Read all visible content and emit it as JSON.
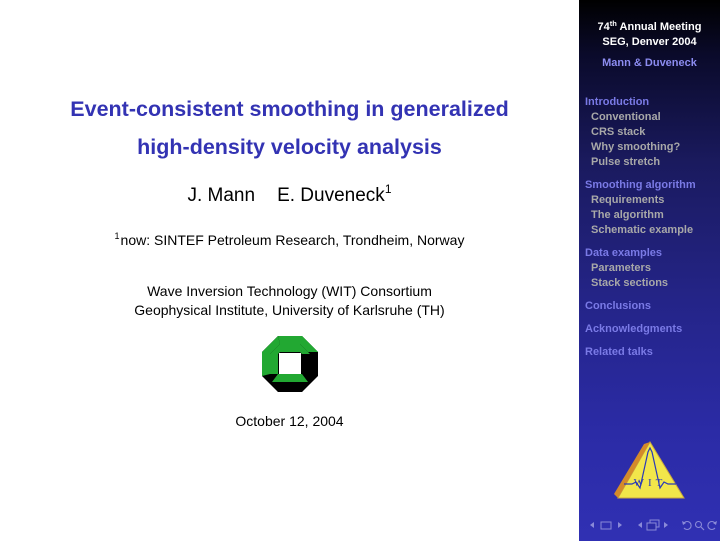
{
  "slide": {
    "title_line1": "Event-consistent smoothing in generalized",
    "title_line2": "high-density velocity analysis",
    "author1": "J. Mann",
    "author2": "E. Duveneck",
    "author2_footnote_mark": "1",
    "affiliation_mark": "1",
    "affiliation": "now: SINTEF Petroleum Research, Trondheim, Norway",
    "institution_line1": "Wave Inversion Technology (WIT) Consortium",
    "institution_line2": "Geophysical Institute, University of Karlsruhe (TH)",
    "date": "October 12, 2004",
    "title_color": "#3333b3"
  },
  "sidebar": {
    "meeting_number": "74",
    "meeting_sup": "th",
    "meeting_rest": " Annual Meeting",
    "meeting_line2": "SEG, Denver 2004",
    "authors": "Mann & Duveneck",
    "section_color": "#7a7ae6",
    "subsection_color": "#a8a8a8",
    "sections": [
      {
        "label": "Introduction",
        "items": [
          "Conventional",
          "CRS stack",
          "Why smoothing?",
          "Pulse stretch"
        ]
      },
      {
        "label": "Smoothing algorithm",
        "items": [
          "Requirements",
          "The algorithm",
          "Schematic example"
        ]
      },
      {
        "label": "Data examples",
        "items": [
          "Parameters",
          "Stack sections"
        ]
      },
      {
        "label": "Conclusions",
        "items": []
      },
      {
        "label": "Acknowledgments",
        "items": []
      },
      {
        "label": "Related talks",
        "items": []
      }
    ],
    "wit_logo_text": "WIT"
  },
  "navigation": {
    "icons": [
      "prev-arrow-icon",
      "frame-icon",
      "next-arrow-icon",
      "prev-section-arrow-icon",
      "section-icon",
      "next-section-arrow-icon",
      "back-icon",
      "search-icon",
      "forward-icon"
    ]
  }
}
